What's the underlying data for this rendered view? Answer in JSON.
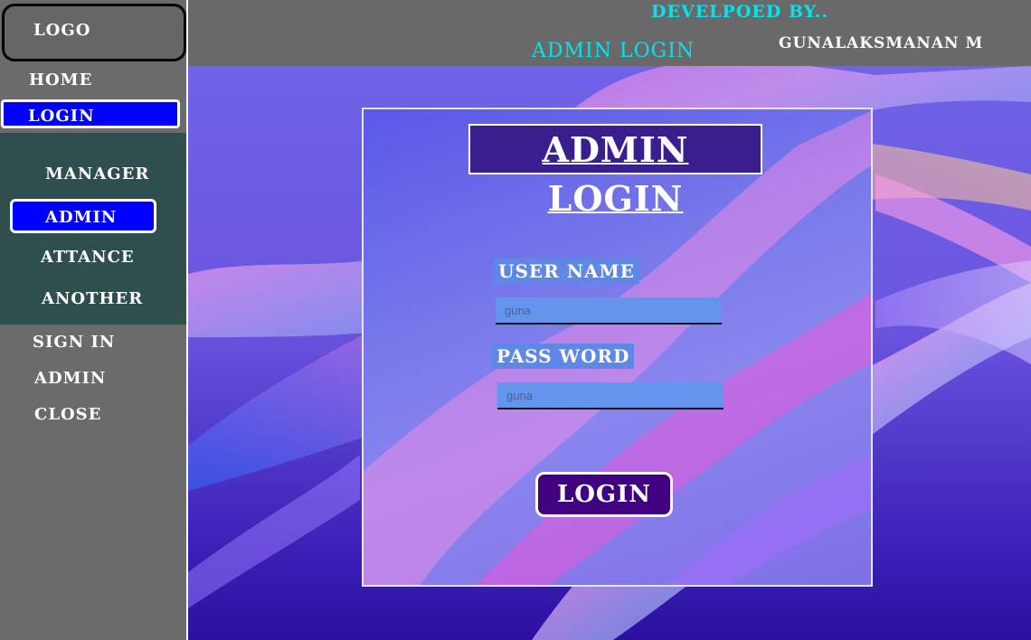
{
  "sidebar": {
    "logo": "LOGO",
    "items": [
      {
        "label": "HOME"
      },
      {
        "label": "LOGIN"
      }
    ],
    "submenu": [
      {
        "label": "MANAGER"
      },
      {
        "label": "ADMIN"
      },
      {
        "label": "ATTANCE"
      },
      {
        "label": "ANOTHER"
      }
    ],
    "footer_items": [
      {
        "label": "SIGN IN"
      },
      {
        "label": "ADMIN"
      },
      {
        "label": "CLOSE"
      }
    ]
  },
  "header": {
    "developed_by": "DEVELPOED BY..",
    "title": "ADMIN LOGIN",
    "developer_name": "GUNALAKSMANAN M"
  },
  "form": {
    "title": "ADMIN LOGIN",
    "username_label": "USER NAME",
    "username_placeholder": "guna",
    "password_label": "PASS WORD",
    "password_placeholder": "guna",
    "submit_label": "LOGIN"
  },
  "colors": {
    "sidebar_bg": "#6b6b6b",
    "submenu_bg": "#2f4f4f",
    "active_blue": "#0000ff",
    "header_accent": "#00e5ee",
    "card_title_bg": "#3b1e8e",
    "input_bg": "#6495ed",
    "button_bg": "#400080"
  }
}
